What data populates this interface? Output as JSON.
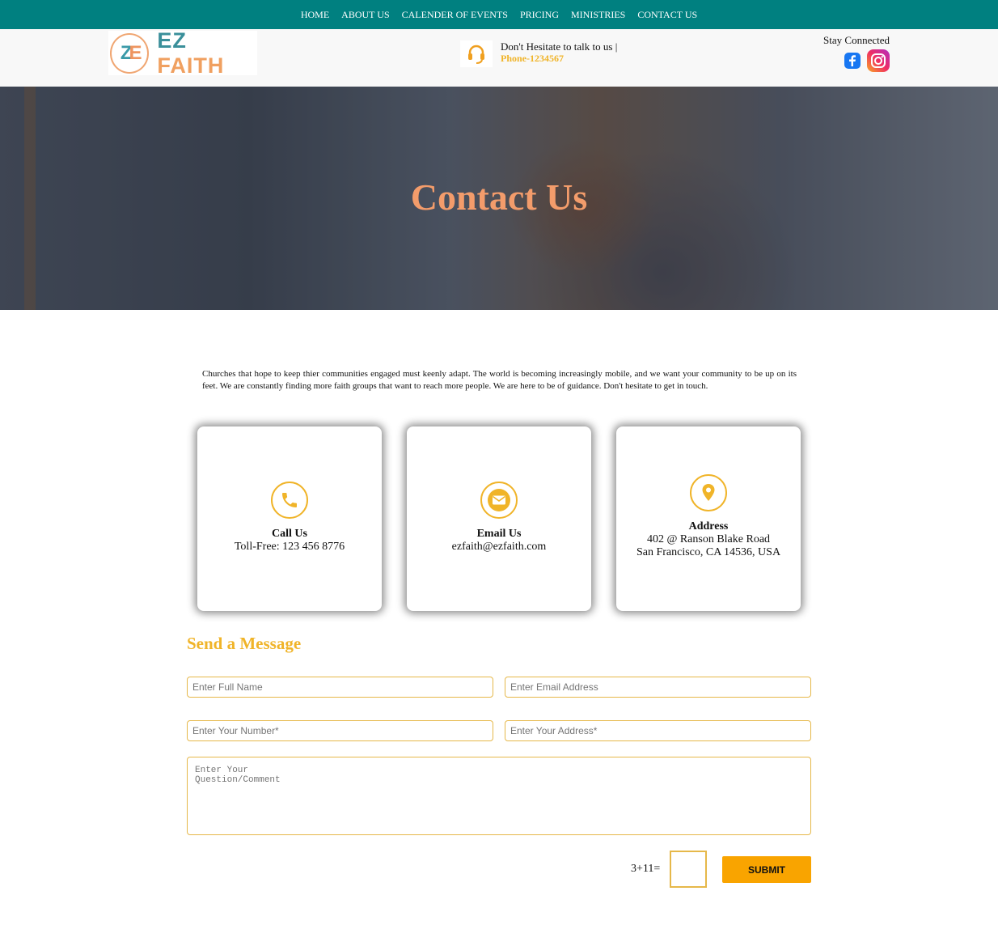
{
  "nav": {
    "items": [
      "HOME",
      "ABOUT US",
      "CALENDER OF EVENTS",
      "PRICING",
      "MINISTRIES",
      "CONTACT US"
    ]
  },
  "header": {
    "logo_text_1": "EZ",
    "logo_text_2": "FAITH",
    "hesitate_text": "Don't Hesitate to talk to us |",
    "phone_text": "Phone-1234567",
    "stay_connected": "Stay Connected"
  },
  "hero": {
    "title": "Contact Us"
  },
  "intro": {
    "text": "Churches that hope to keep thier communities engaged must keenly adapt. The world is becoming increasingly mobile, and we want your community to be up on its feet. We are constantly finding more faith groups that want to reach more people. We are here to be of guidance. Don't hesitate to get in touch."
  },
  "cards": {
    "call": {
      "title": "Call Us",
      "line1": "Toll-Free: 123 456 8776"
    },
    "email": {
      "title": "Email Us",
      "line1": "ezfaith@ezfaith.com"
    },
    "address": {
      "title": "Address",
      "line1": "402 @ Ranson Blake Road",
      "line2": "San Francisco, CA 14536, USA"
    }
  },
  "form": {
    "title": "Send a Message",
    "full_name_placeholder": "Enter Full Name",
    "email_placeholder": "Enter Email Address",
    "number_placeholder": "Enter Your Number*",
    "address_placeholder": "Enter Your Address*",
    "comment_placeholder": "Enter Your\nQuestion/Comment",
    "captcha_label": "3+11=",
    "submit_label": "SUBMIT"
  },
  "colors": {
    "nav_bg": "#008080",
    "accent": "#f0b429",
    "hero_title": "#f39c6b",
    "submit_bg": "#f9a400"
  }
}
